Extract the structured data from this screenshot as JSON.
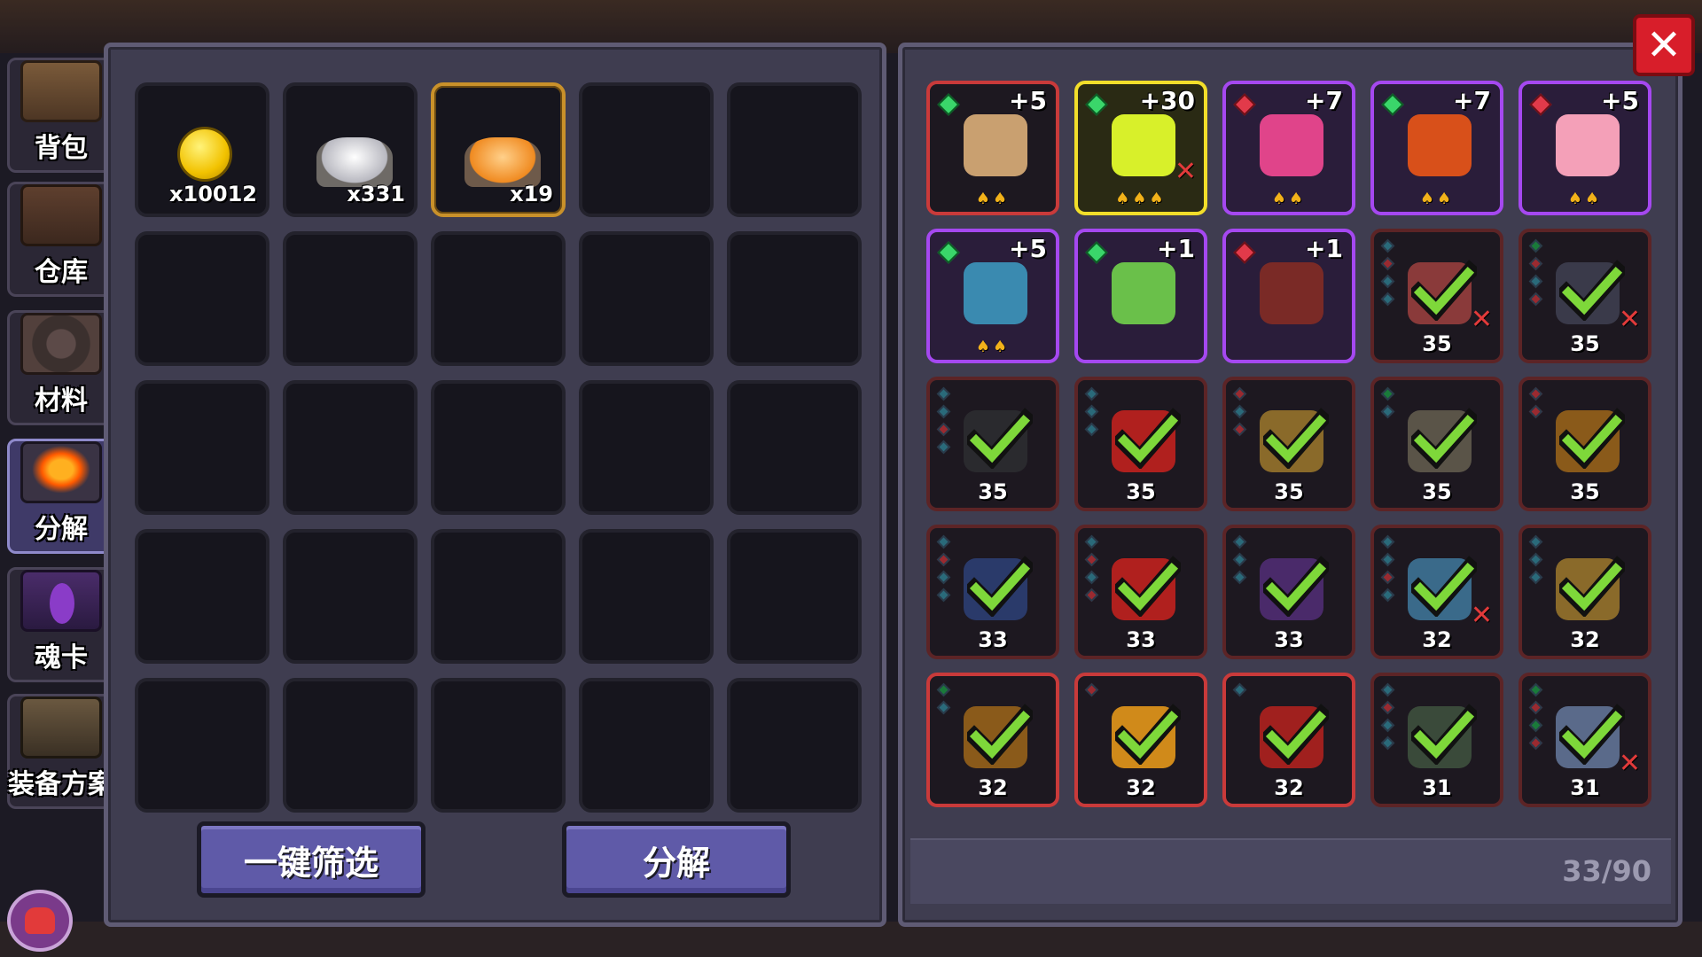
{
  "sidebar": {
    "tabs": [
      {
        "label": "背包",
        "icon": "chest-icon",
        "active": false
      },
      {
        "label": "仓库",
        "icon": "warehouse-chest-icon",
        "active": false
      },
      {
        "label": "材料",
        "icon": "material-icon",
        "active": false
      },
      {
        "label": "分解",
        "icon": "furnace-icon",
        "active": true
      },
      {
        "label": "魂卡",
        "icon": "soul-card-icon",
        "active": false
      },
      {
        "label": "装备方案",
        "icon": "armor-set-icon",
        "active": false
      }
    ]
  },
  "materials": [
    {
      "name": "gold-coin",
      "qty": "x10012"
    },
    {
      "name": "white-ore",
      "qty": "x331"
    },
    {
      "name": "orange-ore",
      "qty": "x19",
      "selected": true
    }
  ],
  "buttons": {
    "filter": "一键筛选",
    "decompose": "分解"
  },
  "equipment": [
    {
      "plus": "+5",
      "gem": "green",
      "stars": "♠♠",
      "border": "red",
      "color": "#c9a070"
    },
    {
      "plus": "+30",
      "gem": "green",
      "stars": "♠♠♠",
      "border": "gold",
      "color": "#d8f02a",
      "x": true
    },
    {
      "plus": "+7",
      "gem": "red",
      "stars": "♠♠",
      "border": "purple",
      "color": "#e0448a"
    },
    {
      "plus": "+7",
      "gem": "green",
      "stars": "♠♠",
      "border": "purple",
      "color": "#d8501a"
    },
    {
      "plus": "+5",
      "gem": "red",
      "stars": "♠♠",
      "border": "purple",
      "color": "#f4a0b8"
    },
    {
      "plus": "+5",
      "gem": "green",
      "stars": "♠♠",
      "border": "purple",
      "color": "#3a8ab0"
    },
    {
      "plus": "+1",
      "gem": "green",
      "border": "purple",
      "color": "#6ac04a"
    },
    {
      "plus": "+1",
      "gem": "red",
      "border": "purple",
      "color": "#7a2a26"
    },
    {
      "level": "35",
      "border": "darkred",
      "color": "#8a3a3a",
      "sockets": [
        "blue",
        "red",
        "blue",
        "blue"
      ],
      "check": true,
      "x": true
    },
    {
      "level": "35",
      "border": "darkred",
      "color": "#3a3a4a",
      "sockets": [
        "green",
        "red",
        "blue",
        "red"
      ],
      "check": true,
      "x": true
    },
    {
      "level": "35",
      "border": "darkred",
      "color": "#2a2a2e",
      "sockets": [
        "blue",
        "blue",
        "red",
        "blue"
      ],
      "check": true
    },
    {
      "level": "35",
      "border": "darkred",
      "color": "#b0201e",
      "sockets": [
        "blue",
        "blue",
        "blue"
      ],
      "check": true
    },
    {
      "level": "35",
      "border": "darkred",
      "color": "#8a6a2a",
      "sockets": [
        "red",
        "blue",
        "red"
      ],
      "check": true
    },
    {
      "level": "35",
      "border": "darkred",
      "color": "#5a5448",
      "sockets": [
        "green",
        "blue"
      ],
      "check": true
    },
    {
      "level": "35",
      "border": "darkred",
      "color": "#8a5a1a",
      "sockets": [
        "red",
        "red"
      ],
      "check": true
    },
    {
      "level": "33",
      "border": "darkred",
      "color": "#2a3a6a",
      "sockets": [
        "blue",
        "red",
        "blue",
        "blue"
      ],
      "check": true
    },
    {
      "level": "33",
      "border": "darkred",
      "color": "#b0201e",
      "sockets": [
        "blue",
        "red",
        "blue",
        "red"
      ],
      "check": true
    },
    {
      "level": "33",
      "border": "darkred",
      "color": "#4a2a6a",
      "sockets": [
        "blue",
        "blue",
        "blue"
      ],
      "check": true
    },
    {
      "level": "32",
      "border": "darkred",
      "color": "#3a6a8a",
      "sockets": [
        "blue",
        "blue",
        "red",
        "blue"
      ],
      "check": true,
      "x": true
    },
    {
      "level": "32",
      "border": "darkred",
      "color": "#8a6a2a",
      "sockets": [
        "blue",
        "blue",
        "blue"
      ],
      "check": true
    },
    {
      "level": "32",
      "border": "red",
      "color": "#8a5a1a",
      "sockets": [
        "green",
        "blue"
      ],
      "check": true
    },
    {
      "level": "32",
      "border": "red",
      "color": "#d08a1a",
      "sockets": [
        "red"
      ],
      "check": true
    },
    {
      "level": "32",
      "border": "red",
      "color": "#a0201e",
      "sockets": [
        "blue"
      ],
      "check": true
    },
    {
      "level": "31",
      "border": "darkred",
      "color": "#3a4a3a",
      "sockets": [
        "blue",
        "red",
        "blue",
        "blue"
      ],
      "check": true
    },
    {
      "level": "31",
      "border": "darkred",
      "color": "#5a6a8a",
      "sockets": [
        "green",
        "red",
        "green",
        "red"
      ],
      "check": true,
      "x": true
    }
  ],
  "inventory_count": "33/90",
  "close_label": "✕"
}
